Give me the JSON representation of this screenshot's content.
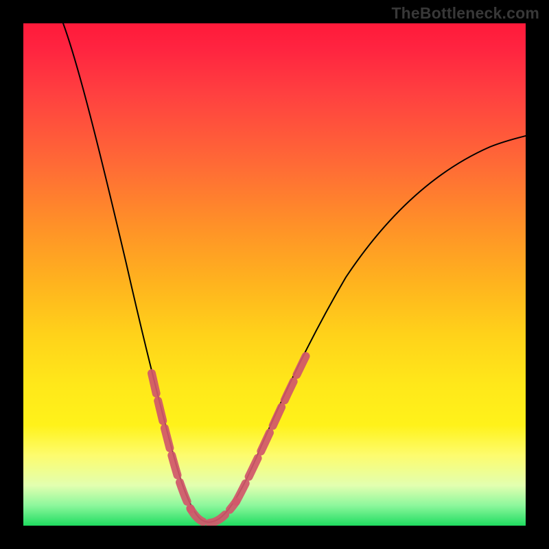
{
  "watermark": "TheBottleneck.com",
  "chart_data": {
    "type": "line",
    "title": "",
    "xlabel": "",
    "ylabel": "",
    "xlim": [
      0,
      100
    ],
    "ylim": [
      0,
      100
    ],
    "grid": false,
    "legend": false,
    "background_gradient": {
      "top": "#ff1a3a",
      "mid": "#ffe81a",
      "bottom": "#1fdc60"
    },
    "series": [
      {
        "name": "bottleneck-curve",
        "color": "#000000",
        "x": [
          0,
          5,
          10,
          15,
          20,
          22,
          25,
          28,
          30,
          32,
          34,
          36,
          40,
          45,
          50,
          55,
          60,
          65,
          70,
          75,
          80,
          85,
          90,
          95,
          100
        ],
        "values": [
          100,
          88,
          76,
          63,
          48,
          41,
          31,
          19,
          11,
          5,
          2,
          1,
          2,
          6,
          13,
          21,
          29,
          37,
          45,
          52,
          59,
          65,
          70,
          74,
          77
        ]
      }
    ],
    "overlay_dashed_segments": [
      {
        "name": "left-slope-marker",
        "color": "#d1576a",
        "x_range": [
          20,
          29
        ]
      },
      {
        "name": "valley-marker",
        "color": "#d1576a",
        "x_range": [
          29,
          42
        ]
      },
      {
        "name": "right-slope-marker",
        "color": "#d1576a",
        "x_range": [
          42,
          53
        ]
      }
    ]
  }
}
